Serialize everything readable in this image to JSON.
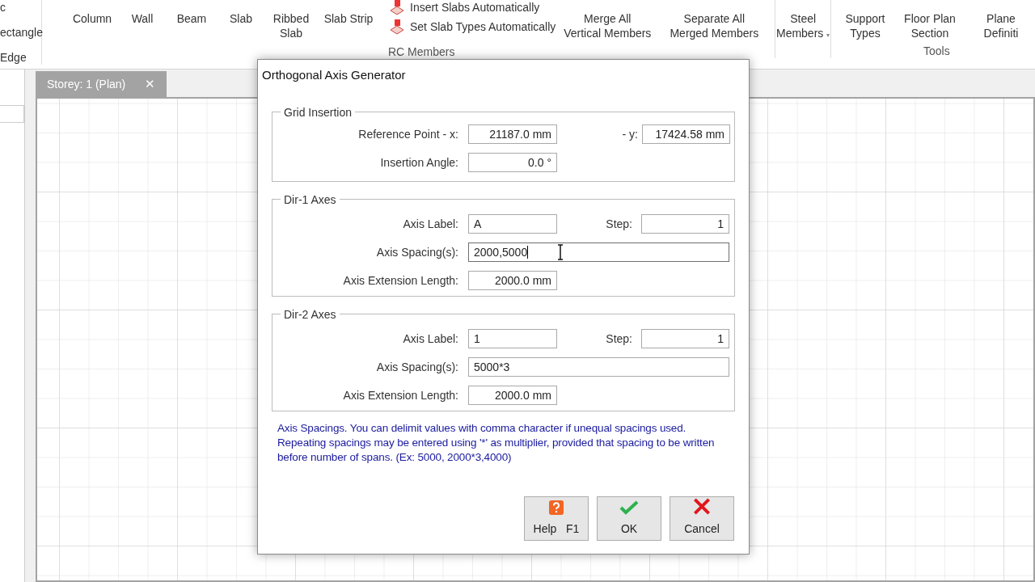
{
  "ribbon": {
    "left_items": [
      "c",
      "ectangle",
      "Edge"
    ],
    "buttons": [
      {
        "label": [
          "Column"
        ],
        "kind": "large"
      },
      {
        "label": [
          "Wall"
        ],
        "kind": "large"
      },
      {
        "label": [
          "Beam"
        ],
        "kind": "large"
      },
      {
        "label": [
          "Slab"
        ],
        "kind": "large"
      },
      {
        "label": [
          "Ribbed",
          "Slab"
        ],
        "kind": "large"
      },
      {
        "label": [
          "Slab Strip"
        ],
        "kind": "large"
      }
    ],
    "small_buttons": [
      "Insert Slabs Automatically",
      "Set Slab Types Automatically"
    ],
    "rc_group": "RC Members",
    "merge_buttons": [
      [
        "Merge All",
        "Vertical Members"
      ],
      [
        "Separate All",
        "Merged Members"
      ]
    ],
    "steel": {
      "label": [
        "Steel",
        "Members"
      ],
      "caret": "▾"
    },
    "tools_buttons": [
      [
        "Support",
        "Types"
      ],
      [
        "Floor Plan",
        "Section"
      ],
      [
        "Plane",
        "Definiti"
      ]
    ],
    "tools_group": "Tools"
  },
  "doc_tab": {
    "label": "Storey: 1 (Plan)",
    "close": "✕"
  },
  "dialog": {
    "title": "Orthogonal Axis Generator",
    "grid_insertion": {
      "title": "Grid Insertion",
      "ref_x": {
        "label": "Reference Point - x:",
        "value": "21187.0 mm"
      },
      "ref_y": {
        "label": "- y:",
        "value": "17424.58 mm"
      },
      "angle": {
        "label": "Insertion Angle:",
        "value": "0.0 °"
      }
    },
    "axes": [
      {
        "title": "Dir-1 Axes",
        "axis_label": {
          "label": "Axis Label:",
          "value": "A"
        },
        "step": {
          "label": "Step:",
          "value": "1"
        },
        "spacing": {
          "label": "Axis Spacing(s):",
          "value": "2000,5000",
          "focused": true
        },
        "extension": {
          "label": "Axis Extension Length:",
          "value": "2000.0 mm"
        }
      },
      {
        "title": "Dir-2 Axes",
        "axis_label": {
          "label": "Axis Label:",
          "value": "1"
        },
        "step": {
          "label": "Step:",
          "value": "1"
        },
        "spacing": {
          "label": "Axis Spacing(s):",
          "value": "5000*3",
          "focused": false
        },
        "extension": {
          "label": "Axis Extension Length:",
          "value": "2000.0 mm"
        }
      }
    ],
    "hint": "Axis Spacings. You can delimit values with comma character if unequal spacings used. Repeating spacings may be entered using '*' as multiplier, provided that spacing to be written before number of spans. (Ex: 5000, 2000*3,4000)",
    "buttons": [
      {
        "kind": "help",
        "label": "Help",
        "key": "F1"
      },
      {
        "kind": "ok",
        "label": "OK"
      },
      {
        "kind": "cancel",
        "label": "Cancel"
      }
    ]
  }
}
